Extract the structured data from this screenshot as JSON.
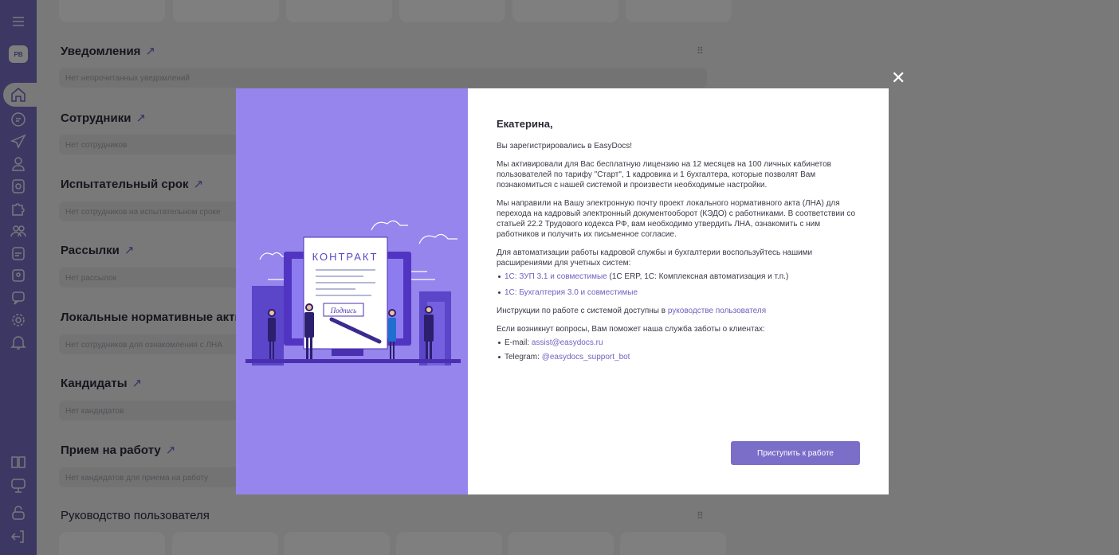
{
  "sidebar": {
    "avatar_initials": "PB",
    "top_icons": [
      "menu-icon"
    ],
    "icons": [
      "home-icon",
      "document-icon",
      "send-icon",
      "user-icon",
      "money-icon",
      "puzzle-icon",
      "team-icon",
      "calendar-icon",
      "badge-icon",
      "chat-icon",
      "settings-icon",
      "bell-icon"
    ],
    "bottom_icons": [
      "book-icon",
      "chat-support-icon",
      "lock-icon",
      "logout-icon"
    ]
  },
  "sections": [
    {
      "title": "Уведомления",
      "empty": "Нет непрочитанных уведомлений"
    },
    {
      "title": "Сотрудники",
      "empty": "Нет сотрудников"
    },
    {
      "title": "Испытательный срок",
      "empty": "Нет сотрудников на испытательном сроке"
    },
    {
      "title": "Рассылки",
      "empty": "Нет рассылок"
    },
    {
      "title": "Локальные нормативные акты",
      "empty": "Нет сотрудников для ознакомления с ЛНА"
    },
    {
      "title": "Кандидаты",
      "empty": "Нет кандидатов"
    },
    {
      "title": "Прием на работу",
      "empty": "Нет кандидатов для приема на работу"
    }
  ],
  "user_guide_title": "Руководство пользователя",
  "modal": {
    "greeting": "Екатерина,",
    "p1": "Вы зарегистрировались в EasyDocs!",
    "p2": "Мы активировали для Вас бесплатную лицензию на 12 месяцев на 100 личных кабинетов пользователей по тарифу \"Старт\", 1 кадровика и 1 бухгалтера, которые позволят Вам познакомиться с нашей системой и произвести необходимые настройки.",
    "p3": "Мы направили на Вашу электронную почту проект локального нормативного акта (ЛНА) для перехода на кадровый электронный документооборот (КЭДО) с работниками. В соответствии со статьей 22.2 Трудового кодекса РФ, вам необходимо утвердить ЛНА, ознакомить с ним работников и получить их письменное согласие.",
    "p4": "Для автоматизации работы кадровой службы и бухгалтерии воспользуйтесь нашими расширениями для учетных систем:",
    "ext1_link": "1С: ЗУП 3.1 и совместимые",
    "ext1_rest": " (1С ERP, 1С: Комплексная автоматизация и т.п.)",
    "ext2_link": "1С: Бухгалтерия 3.0 и совместимые",
    "p5_text": "Инструкции по работе с системой доступны в ",
    "p5_link": "руководстве пользователя",
    "p6": "Если возникнут вопросы, Вам поможет наша служба заботы о клиентах:",
    "email_label": "E-mail: ",
    "email": "assist@easydocs.ru",
    "telegram_label": "Telegram: ",
    "telegram": "@easydocs_support_bot",
    "cta": "Приступить к работе",
    "illustration": {
      "contract_word": "КОНТРАКТ",
      "signature_word": "Подпись"
    }
  },
  "colors": {
    "accent": "#7b6ec9",
    "illustration_bg": "#9585ec",
    "link": "#6f62c2"
  }
}
